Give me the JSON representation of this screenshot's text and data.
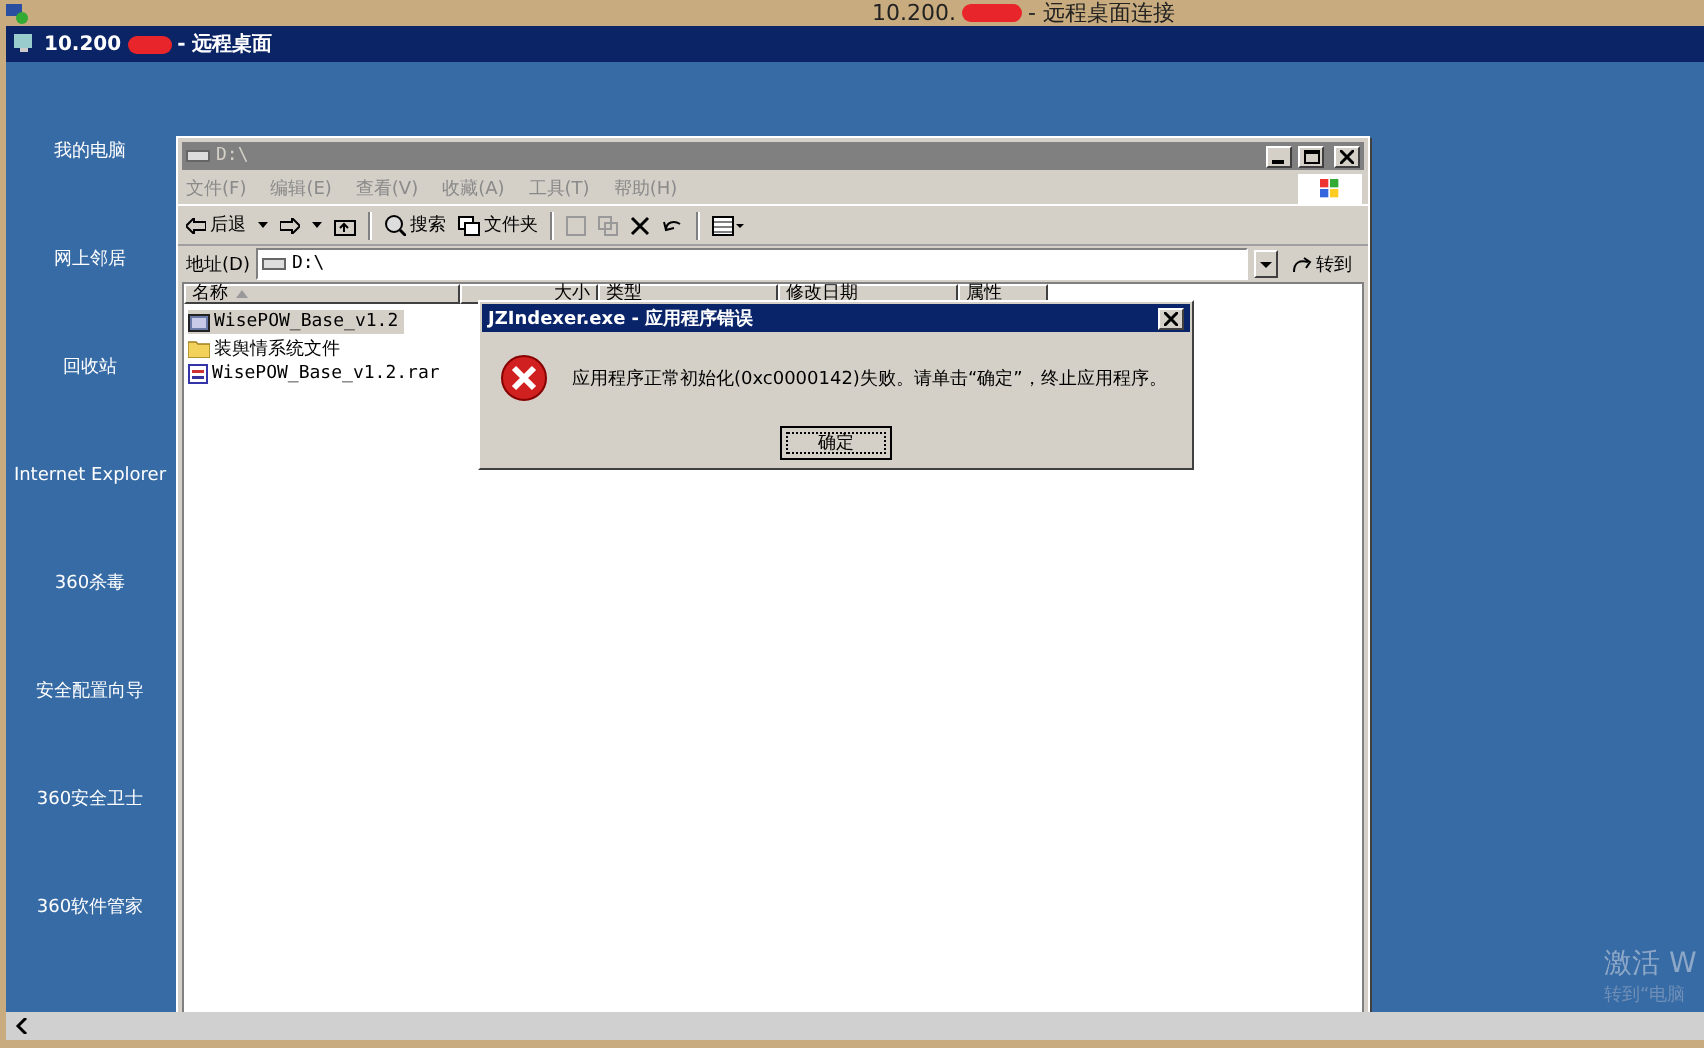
{
  "host_window": {
    "title_start": "10.200.",
    "title_end": "- 远程桌面连接"
  },
  "remote_bar": {
    "title_start": "10.200",
    "title_end": "- 远程桌面"
  },
  "desktop_icons": [
    {
      "label": "我的电脑"
    },
    {
      "label": "网上邻居"
    },
    {
      "label": "回收站"
    },
    {
      "label": "Internet Explorer"
    },
    {
      "label": "360杀毒"
    },
    {
      "label": "安全配置向导"
    },
    {
      "label": "360安全卫士"
    },
    {
      "label": "360软件管家"
    }
  ],
  "explorer": {
    "title": "D:\\",
    "menu": [
      "文件(F)",
      "编辑(E)",
      "查看(V)",
      "收藏(A)",
      "工具(T)",
      "帮助(H)"
    ],
    "toolbar": {
      "back": "后退",
      "search": "搜索",
      "folders": "文件夹"
    },
    "address": {
      "label": "地址(D)",
      "value": "D:\\",
      "go": "转到"
    },
    "columns": [
      {
        "label": "名称",
        "sorted": true
      },
      {
        "label": "大小",
        "sorted": false
      },
      {
        "label": "类型",
        "sorted": false
      },
      {
        "label": "修改日期",
        "sorted": false
      },
      {
        "label": "属性",
        "sorted": false
      }
    ],
    "files": [
      {
        "name": "WisePOW_Base_v1.2",
        "kind": "app-folder",
        "selected": true
      },
      {
        "name": "装舆情系统文件",
        "kind": "folder",
        "selected": false
      },
      {
        "name": "WisePOW_Base_v1.2.rar",
        "kind": "archive",
        "selected": false
      }
    ]
  },
  "dialog": {
    "title": "JZIndexer.exe - 应用程序错误",
    "message": "应用程序正常初始化(0xc0000142)失败。请单击“确定”，终止应用程序。",
    "button": "确定"
  },
  "activation_notice": {
    "title": "激活 W",
    "subtitle": "转到“电脑"
  }
}
